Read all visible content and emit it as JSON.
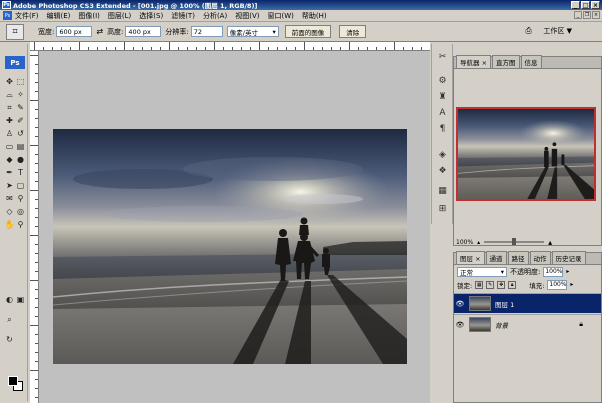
{
  "window": {
    "title": "Adobe Photoshop CS3 Extended - [001.jpg @ 100% (图层 1, RGB/8)]"
  },
  "menu": [
    "文件(F)",
    "编辑(E)",
    "图像(I)",
    "图层(L)",
    "选择(S)",
    "滤镜(T)",
    "分析(A)",
    "视图(V)",
    "窗口(W)",
    "帮助(H)"
  ],
  "options": {
    "width_label": "宽度:",
    "width_value": "600 px",
    "height_label": "高度:",
    "height_value": "400 px",
    "resolution_label": "分辨率:",
    "resolution_value": "72",
    "unit_value": "像素/英寸",
    "front_image_button": "前面的图像",
    "clear_button": "清除",
    "workspace_label": "工作区 ▼"
  },
  "toolbox": {
    "logo": "Ps"
  },
  "navigator_panel": {
    "tabs": [
      "导航器",
      "直方图",
      "信息"
    ],
    "zoom": "100%"
  },
  "layers_panel": {
    "tabs": [
      "图层",
      "通道",
      "路径",
      "动作",
      "历史记录"
    ],
    "blend_mode": "正常",
    "opacity_label": "不透明度:",
    "opacity_value": "100%",
    "lock_label": "锁定:",
    "fill_label": "填充:",
    "fill_value": "100%",
    "layers": [
      {
        "name": "图层 1",
        "selected": true
      },
      {
        "name": "背景",
        "selected": false
      }
    ]
  },
  "colors": {
    "selection": "#0a246a",
    "navigator_box": "#c03030"
  }
}
